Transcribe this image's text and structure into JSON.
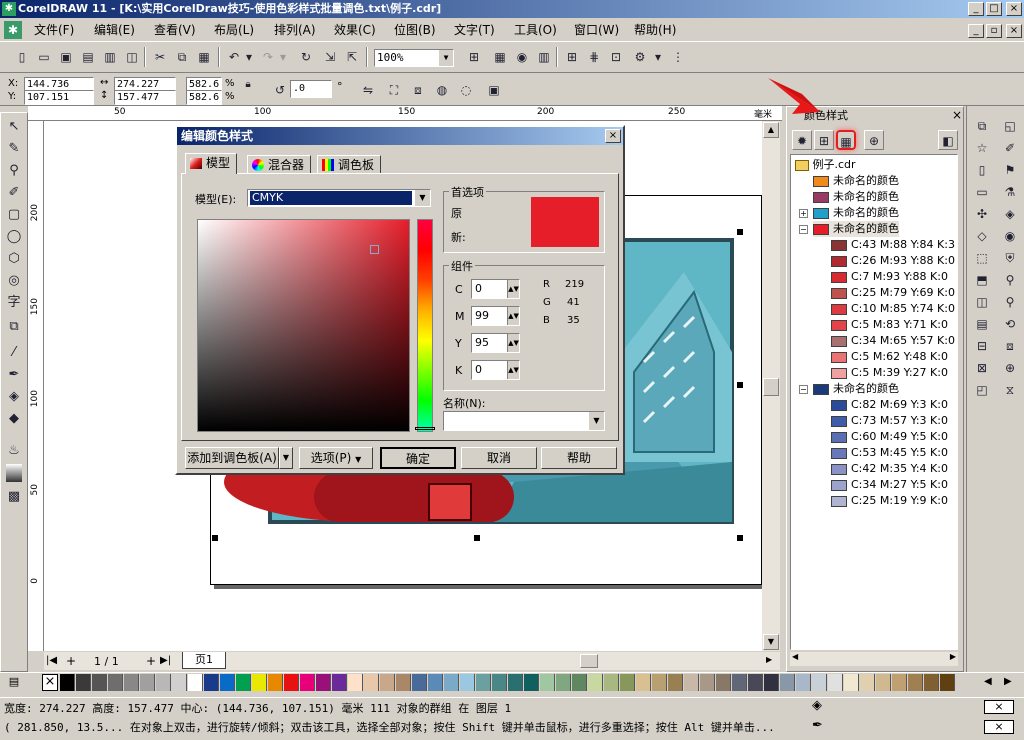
{
  "window": {
    "title": "CorelDRAW 11 - [K:\\实用CorelDraw技巧-使用色彩样式批量调色.txt\\例子.cdr]",
    "min_btn": "_",
    "max_btn": "□",
    "close_btn": "×"
  },
  "menu": [
    "文件(F)",
    "编辑(E)",
    "查看(V)",
    "布局(L)",
    "排列(A)",
    "效果(C)",
    "位图(B)",
    "文字(T)",
    "工具(O)",
    "窗口(W)",
    "帮助(H)"
  ],
  "toolbar": {
    "zoom": "100%"
  },
  "propbar": {
    "x": "144.736",
    "y": "107.151",
    "width": "274.227",
    "height": "157.477",
    "scale_x": "582.6",
    "scale_y": "582.6",
    "pct": "%",
    "rotation": ".0",
    "degree": "°"
  },
  "rulers": {
    "units": "毫米",
    "h_ticks": [
      "50",
      "100",
      "150",
      "200",
      "250"
    ],
    "v_ticks": [
      "200",
      "150",
      "100",
      "50",
      "0"
    ]
  },
  "page_nav": {
    "counter": "1 / 1",
    "tab": "页1"
  },
  "dialog": {
    "title": "编辑颜色样式",
    "tabs": [
      "模型",
      "混合器",
      "调色板"
    ],
    "model_label": "模型(E):",
    "model_value": "CMYK",
    "preferred_label": "首选项",
    "old_label": "原",
    "new_label": "新:",
    "components_label": "组件",
    "c_label": "C",
    "c_value": "0",
    "m_label": "M",
    "m_value": "99",
    "y_label": "Y",
    "y_value": "95",
    "k_label": "K",
    "k_value": "0",
    "r_label": "R",
    "r_value": "219",
    "g_label": "G",
    "g_value": "41",
    "b_label": "B",
    "b_value": "35",
    "name_label": "名称(N):",
    "add_palette": "添加到调色板(A)",
    "options": "选项(P)",
    "ok": "确定",
    "cancel": "取消",
    "help": "帮助",
    "color": "#e51e2a"
  },
  "panel": {
    "title": "颜色样式",
    "root": "例子.cdr",
    "styles": [
      {
        "label": "未命名的颜色",
        "color": "#f08a1c"
      },
      {
        "label": "未命名的颜色",
        "color": "#9a3a64"
      },
      {
        "label": "未命名的颜色",
        "color": "#22a0c8"
      },
      {
        "label": "未命名的颜色",
        "color": "#e51e2a"
      }
    ],
    "red_shades": [
      {
        "label": "C:43 M:88 Y:84 K:3",
        "color": "#8a3434"
      },
      {
        "label": "C:26 M:93 Y:88 K:0",
        "color": "#b02a30"
      },
      {
        "label": "C:7 M:93 Y:88 K:0",
        "color": "#d82a30"
      },
      {
        "label": "C:25 M:79 Y:69 K:0",
        "color": "#c0524e"
      },
      {
        "label": "C:10 M:85 Y:74 K:0",
        "color": "#dc3c40"
      },
      {
        "label": "C:5 M:83 Y:71 K:0",
        "color": "#e24448"
      },
      {
        "label": "C:34 M:65 Y:57 K:0",
        "color": "#a87070"
      },
      {
        "label": "C:5 M:62 Y:48 K:0",
        "color": "#ea7474"
      },
      {
        "label": "C:5 M:39 Y:27 K:0",
        "color": "#f0a0a0"
      }
    ],
    "blue_style": {
      "label": "未命名的颜色",
      "color": "#1a3a7a"
    },
    "blue_shades": [
      {
        "label": "C:82 M:69 Y:3 K:0",
        "color": "#2a4a9a"
      },
      {
        "label": "C:73 M:57 Y:3 K:0",
        "color": "#3e5eaa"
      },
      {
        "label": "C:60 M:49 Y:5 K:0",
        "color": "#5a6eb4"
      },
      {
        "label": "C:53 M:45 Y:5 K:0",
        "color": "#6a78ba"
      },
      {
        "label": "C:42 M:35 Y:4 K:0",
        "color": "#8a92c6"
      },
      {
        "label": "C:34 M:27 Y:5 K:0",
        "color": "#9ca4ce"
      },
      {
        "label": "C:25 M:19 Y:9 K:0",
        "color": "#b0b4d0"
      }
    ]
  },
  "palette": [
    "#000000",
    "#3a3a3a",
    "#555555",
    "#6e6e6e",
    "#888888",
    "#a0a0a0",
    "#b8b8b8",
    "#d0d0d0",
    "#ffffff",
    "#1a3a8a",
    "#0a6ac8",
    "#00a050",
    "#e8e800",
    "#e88800",
    "#e81010",
    "#e8007a",
    "#9a107a",
    "#6a2a9a",
    "#ffe0c8",
    "#e8c8a8",
    "#c8a888",
    "#a88868",
    "#4a6a9a",
    "#5a8ab8",
    "#7aaac8",
    "#9ac8e0",
    "#6aa0a0",
    "#4a8888",
    "#2a7070",
    "#106060",
    "#a0c8a0",
    "#80a880",
    "#608860",
    "#c8d8a0",
    "#a8b880",
    "#88985a",
    "#d8c090",
    "#b8a070",
    "#988050",
    "#c8b8a8",
    "#a89888",
    "#887868",
    "#606878",
    "#484858",
    "#303040",
    "#8898a8",
    "#a8b8c8",
    "#c8d0d8",
    "#e0e0e0",
    "#f0e8d0",
    "#e0d0b0",
    "#d0b890",
    "#c0a070",
    "#a08050",
    "#806030",
    "#604010"
  ],
  "status": {
    "line1": "宽度: 274.227  高度: 157.477  中心: (144.736, 107.151)  毫米      111 对象的群组 在 图层 1",
    "line2": "( 281.850, 13.5...  在对象上双击，进行旋转/倾斜；双击该工具，选择全部对象；按住 Shift 键并单击鼠标，进行多重选择；按住 Alt 键并单击..."
  }
}
